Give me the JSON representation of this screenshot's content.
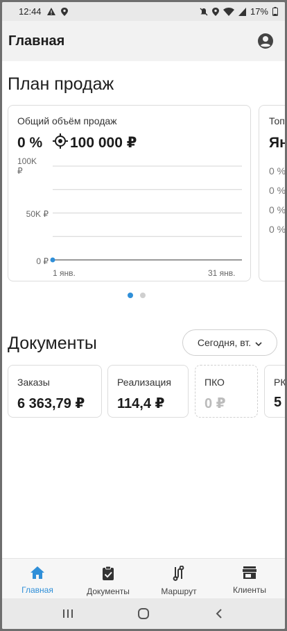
{
  "status_bar": {
    "time": "12:44",
    "battery": "17%"
  },
  "app_bar": {
    "title": "Главная"
  },
  "sales_plan": {
    "title": "План продаж",
    "card": {
      "title": "Общий объём продаж",
      "percent": "0 %",
      "target": "100 000 ₽",
      "y_ticks": [
        "100K ₽",
        "50K ₽",
        "0 ₽"
      ],
      "x_ticks": [
        "1 янв.",
        "31 янв."
      ]
    },
    "peek_card": {
      "title": "Топ",
      "headline": "Ян",
      "rows": [
        "0 %",
        "0 %",
        "0 %",
        "0 %"
      ]
    }
  },
  "chart_data": {
    "type": "line",
    "title": "Общий объём продаж",
    "x": [
      "1 янв."
    ],
    "xlabel": "",
    "ylabel": "",
    "x_ticks": [
      "1 янв.",
      "31 янв."
    ],
    "y_ticks": [
      "0 ₽",
      "50K ₽",
      "100K ₽"
    ],
    "ylim": [
      0,
      100000
    ],
    "series": [
      {
        "values": [
          0
        ]
      }
    ],
    "color": "#2f8fd8",
    "grid": true
  },
  "documents": {
    "title": "Документы",
    "period_button": "Сегодня, вт.",
    "cards": [
      {
        "label": "Заказы",
        "value": "6 363,79 ₽"
      },
      {
        "label": "Реализация",
        "value": "114,4 ₽"
      },
      {
        "label": "ПКО",
        "value": "0 ₽"
      },
      {
        "label": "РК",
        "value": "5"
      }
    ]
  },
  "bottom_nav": {
    "items": [
      {
        "label": "Главная",
        "icon": "home-icon",
        "active": true
      },
      {
        "label": "Документы",
        "icon": "clipboard-check-icon",
        "active": false
      },
      {
        "label": "Маршрут",
        "icon": "route-icon",
        "active": false
      },
      {
        "label": "Клиенты",
        "icon": "store-icon",
        "active": false
      }
    ]
  },
  "colors": {
    "accent": "#2f8fd8",
    "app_bar": "#f2f2f2",
    "status_bar": "#e9e9e9"
  }
}
